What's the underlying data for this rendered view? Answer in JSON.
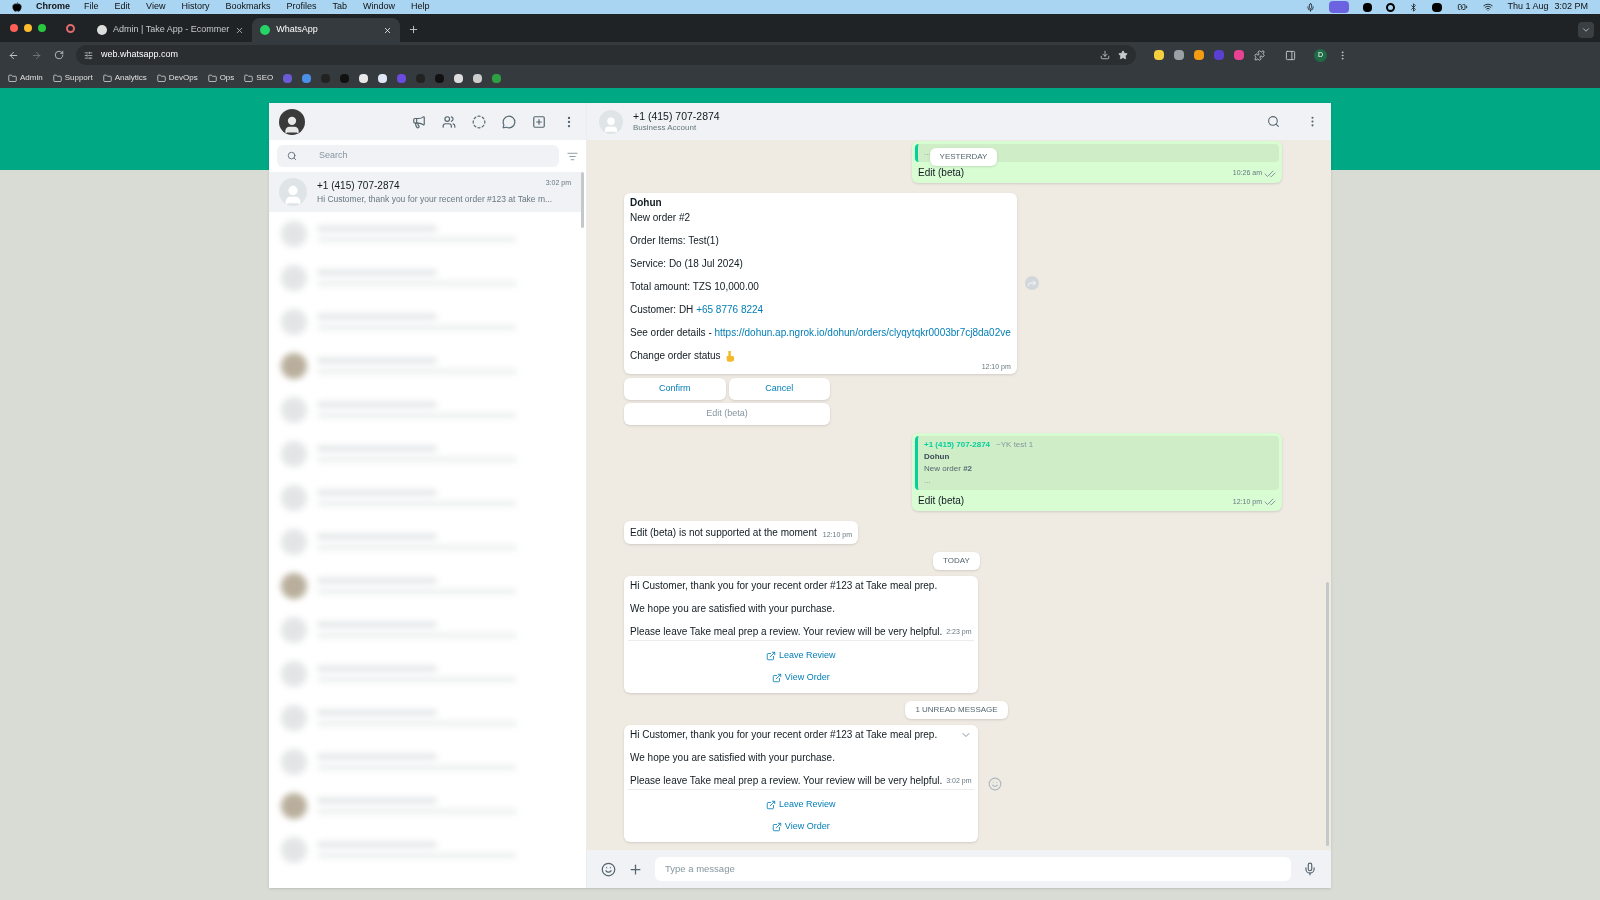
{
  "menu_bar": {
    "app": "Chrome",
    "menus": [
      "File",
      "Edit",
      "View",
      "History",
      "Bookmarks",
      "Profiles",
      "Tab",
      "Window",
      "Help"
    ],
    "date": "Thu 1 Aug",
    "time": "3:02 PM"
  },
  "browser": {
    "tabs": [
      {
        "title": "Admin | Take App - Ecommer",
        "selected": false
      },
      {
        "title": "WhatsApp",
        "selected": true
      }
    ],
    "url": "web.whatsapp.com",
    "bookmarks": [
      "Admin",
      "Support",
      "Analytics",
      "DevOps",
      "Ops",
      "SEO"
    ],
    "profile_initial": "D"
  },
  "sidebar": {
    "search_placeholder": "Search",
    "chats": [
      {
        "name": "+1 (415) 707-2874",
        "time": "3:02 pm",
        "preview": "Hi Customer, thank you for your recent order #123 at Take m...",
        "selected": true
      }
    ]
  },
  "chat": {
    "name": "+1 (415) 707-2874",
    "subtitle": "Business Account",
    "messages": [
      {
        "kind": "date",
        "label": "YESTERDAY"
      },
      {
        "kind": "sent",
        "quote": {
          "more": "..."
        },
        "text": "Edit (beta)",
        "time": "10:26 am",
        "delivered": true
      },
      {
        "kind": "order",
        "sender": "Dohun",
        "paragraphs": [
          {
            "text": "New order #2"
          },
          {
            "text": "Order Items: Test(1)"
          },
          {
            "text": "Service: Do (18 Jul 2024)"
          },
          {
            "text": "Total amount: TZS 10,000.00"
          },
          {
            "text": "Customer: DH ",
            "link": "+65 8776 8224"
          },
          {
            "text": "See order details - ",
            "link": "https://dohun.ap.ngrok.io/dohun/orders/clyqytqkr0003br7cj8da02ve"
          },
          {
            "text": "Change order status",
            "pointer": true
          }
        ],
        "time": "12:10 pm",
        "buttons": [
          {
            "label": "Confirm",
            "disabled": false
          },
          {
            "label": "Cancel",
            "disabled": false
          },
          {
            "label": "Edit (beta)",
            "disabled": true
          }
        ]
      },
      {
        "kind": "sent",
        "quote": {
          "author": "+1 (415) 707-2874",
          "sender": "~YK test 1",
          "title": "Dohun",
          "body": "New order **#2**",
          "more": "..."
        },
        "text": "Edit (beta)",
        "time": "12:10 pm",
        "delivered": true
      },
      {
        "kind": "text",
        "text": "Edit (beta) is not supported at the moment",
        "time": "12:10 pm"
      },
      {
        "kind": "date",
        "label": "TODAY"
      },
      {
        "kind": "template",
        "paragraphs": [
          "Hi Customer, thank you for your recent order #123 at Take meal prep.",
          "We hope you are satisfied with your purchase.",
          "Please leave Take meal prep a review. Your review will be very helpful."
        ],
        "time": "2:23 pm",
        "actions": [
          "Leave Review",
          "View Order"
        ],
        "menu": false
      },
      {
        "kind": "date",
        "label": "1 UNREAD MESSAGE"
      },
      {
        "kind": "template",
        "paragraphs": [
          "Hi Customer, thank you for your recent order #123 at Take meal prep.",
          "We hope you are satisfied with your purchase.",
          "Please leave Take meal prep a review. Your review will be very helpful."
        ],
        "time": "3:02 pm",
        "actions": [
          "Leave Review",
          "View Order"
        ],
        "menu": true
      }
    ],
    "composer_placeholder": "Type a message"
  }
}
